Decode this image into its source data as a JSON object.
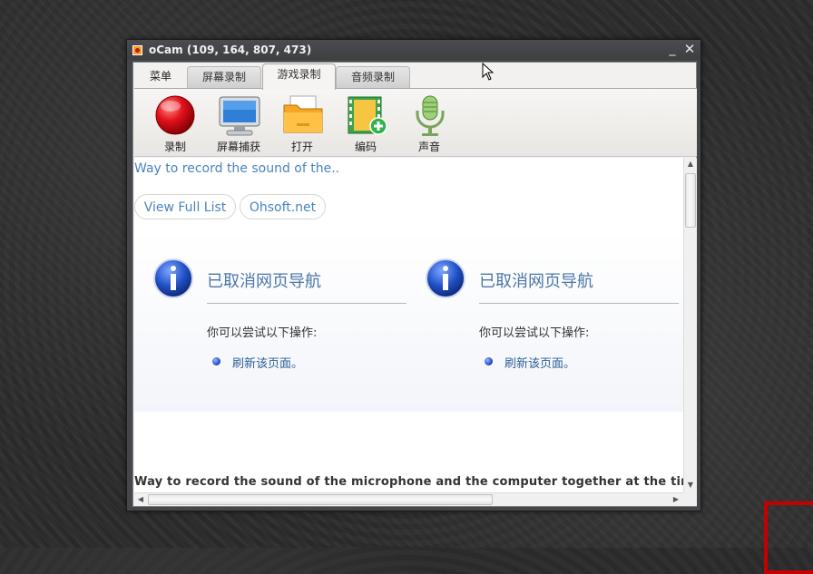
{
  "window": {
    "title": "oCam (109, 164, 807, 473)",
    "minimize_glyph": "_",
    "close_glyph": "✕"
  },
  "tabs": [
    {
      "label": "菜单",
      "active": false
    },
    {
      "label": "屏幕录制",
      "active": false
    },
    {
      "label": "游戏录制",
      "active": true
    },
    {
      "label": "音频录制",
      "active": false
    }
  ],
  "toolbar": {
    "items": [
      {
        "label": "录制",
        "icon": "record-icon"
      },
      {
        "label": "屏幕捕获",
        "icon": "monitor-icon"
      },
      {
        "label": "打开",
        "icon": "folder-icon"
      },
      {
        "label": "编码",
        "icon": "film-icon"
      },
      {
        "label": "声音",
        "icon": "microphone-icon"
      }
    ]
  },
  "browser": {
    "top_link": "Way to record the sound of the..",
    "buttons": [
      "View Full List",
      "Ohsoft.net"
    ],
    "error_panels": [
      {
        "title": "已取消网页导航",
        "subtitle": "你可以尝试以下操作:",
        "action": "刷新该页面。"
      },
      {
        "title": "已取消网页导航",
        "subtitle": "你可以尝试以下操作:",
        "action": "刷新该页面。"
      }
    ],
    "bottom_text": "Way to record the sound of the microphone and the computer together at the time of recording"
  },
  "colors": {
    "link": "#4a83bf",
    "error_title": "#4b76a8",
    "accent_red": "#c40000"
  }
}
